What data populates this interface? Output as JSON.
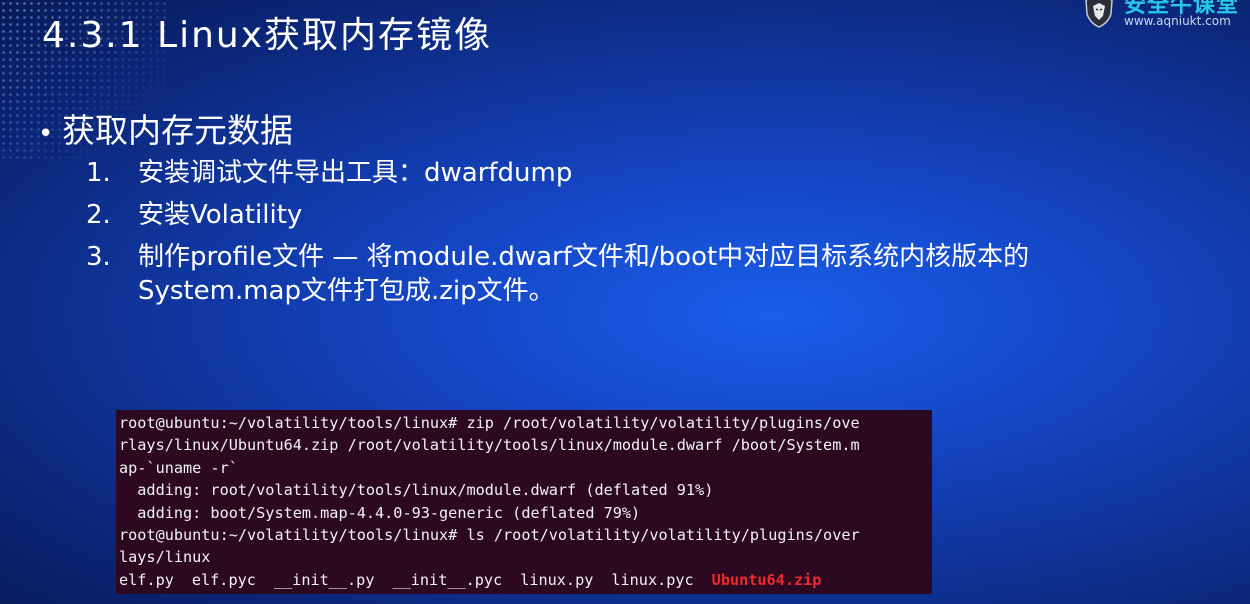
{
  "slide": {
    "title": "4.3.1 Linux获取内存镜像"
  },
  "logo": {
    "name": "安全牛课堂",
    "url": "www.aqniukt.com"
  },
  "content": {
    "bullet": "获取内存元数据",
    "steps": [
      {
        "num": "1.",
        "text": "安装调试文件导出工具：dwarfdump"
      },
      {
        "num": "2.",
        "text": "安装Volatility"
      },
      {
        "num": "3.",
        "text": "制作profile文件 — 将module.dwarf文件和/boot中对应目标系统内核版本的",
        "text2": "System.map文件打包成.zip文件。"
      }
    ]
  },
  "terminal": {
    "lines": [
      "root@ubuntu:~/volatility/tools/linux# zip /root/volatility/volatility/plugins/ove",
      "rlays/linux/Ubuntu64.zip /root/volatility/tools/linux/module.dwarf /boot/System.m",
      "ap-`uname -r`",
      "  adding: root/volatility/tools/linux/module.dwarf (deflated 91%)",
      "  adding: boot/System.map-4.4.0-93-generic (deflated 79%)",
      "root@ubuntu:~/volatility/tools/linux# ls /root/volatility/volatility/plugins/over",
      "lays/linux"
    ],
    "ls_output": [
      "elf.py",
      "elf.pyc",
      "__init__.py",
      "__init__.pyc",
      "linux.py",
      "linux.pyc"
    ],
    "zip_file": "Ubuntu64.zip",
    "zip_color": "#ef2929",
    "background": "#2c0920"
  }
}
